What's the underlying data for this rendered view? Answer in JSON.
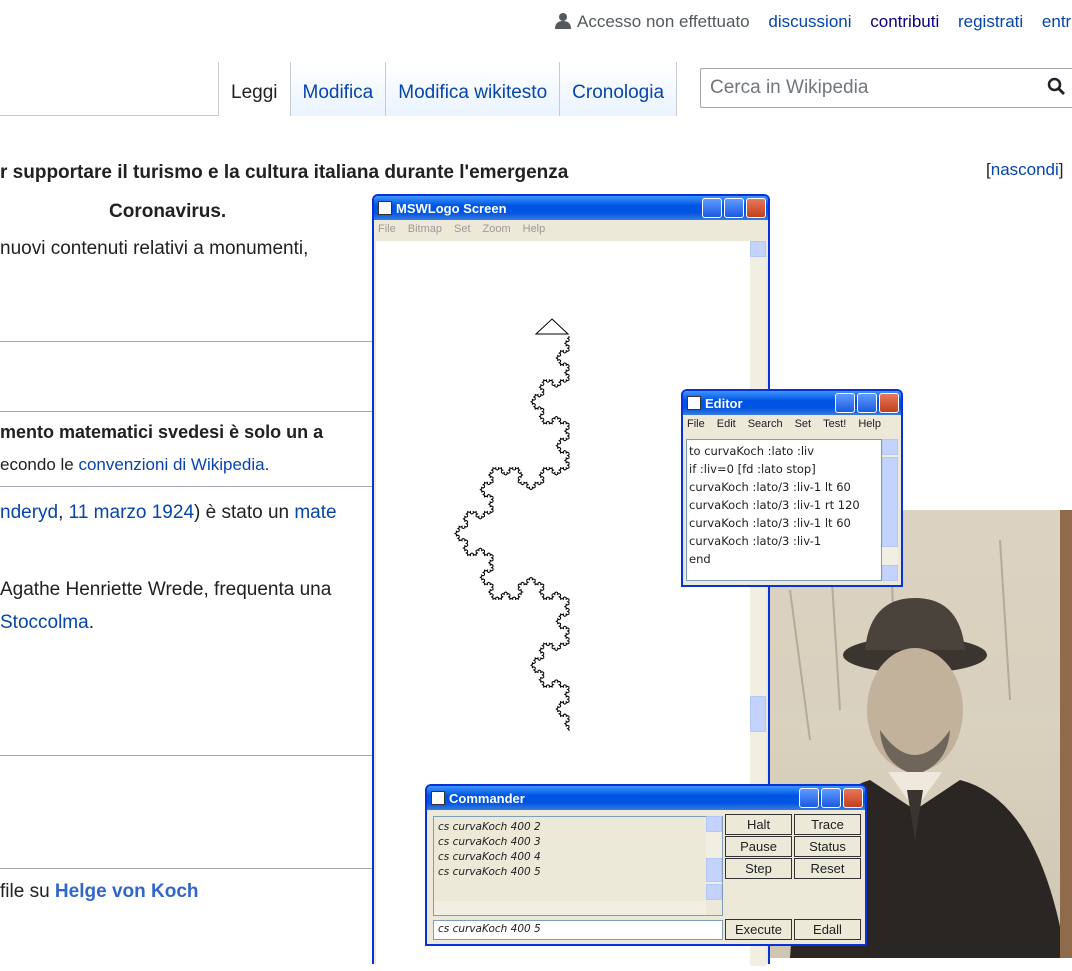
{
  "personal": {
    "anon": "Accesso non effettuato",
    "links": [
      "discussioni",
      "contributi",
      "registrati",
      "entra"
    ]
  },
  "tabs": [
    "Leggi",
    "Modifica",
    "Modifica wikitesto",
    "Cronologia"
  ],
  "search": {
    "placeholder": "Cerca in Wikipedia"
  },
  "banner": {
    "line1": "r supportare il turismo e la cultura italiana durante l'emergenza",
    "line2": "Coronavirus.",
    "line3": " nuovi contenuti relativi a monumenti,",
    "hide_open": "[",
    "hide_link": "nascondi",
    "hide_close": "]"
  },
  "notice": {
    "bold": "mento matematici svedesi è solo un a",
    "prefix": "econdo le ",
    "link": "convenzioni di Wikipedia",
    "suffix": "."
  },
  "article": {
    "l1_link1": "nderyd",
    "l1_sep": ", ",
    "l1_link2": "11 marzo 1924",
    "l1_mid": ") è stato un ",
    "l1_link3": "mate",
    "l2": " Agathe Henriette Wrede, frequenta una",
    "l3_link": "Stoccolma",
    "l3_end": ".",
    "commons_prefix": " file su ",
    "commons_link": "Helge von Koch"
  },
  "mswlogo": {
    "title": "MSWLogo Screen",
    "menu": [
      "File",
      "Bitmap",
      "Set",
      "Zoom",
      "Help"
    ]
  },
  "editor": {
    "title": "Editor",
    "menu": [
      "File",
      "Edit",
      "Search",
      "Set",
      "Test!",
      "Help"
    ],
    "lines": [
      "to curvaKoch :lato :liv",
      "if :liv=0 [fd :lato stop]",
      "curvaKoch :lato/3 :liv-1 lt 60",
      "curvaKoch :lato/3 :liv-1 rt 120",
      "curvaKoch :lato/3 :liv-1 lt 60",
      "curvaKoch :lato/3 :liv-1",
      "end"
    ]
  },
  "commander": {
    "title": "Commander",
    "history": [
      "cs curvaKoch 400 2",
      "cs curvaKoch 400 3",
      "cs curvaKoch 400 4",
      "cs curvaKoch 400 5"
    ],
    "input": "cs curvaKoch 400 5",
    "buttons": {
      "halt": "Halt",
      "trace": "Trace",
      "pause": "Pause",
      "status": "Status",
      "step": "Step",
      "reset": "Reset",
      "execute": "Execute",
      "edall": "Edall"
    }
  },
  "colors": {
    "link": "#0645ad",
    "xp_title": "#0054e3",
    "xp_face": "#ece9d8"
  }
}
